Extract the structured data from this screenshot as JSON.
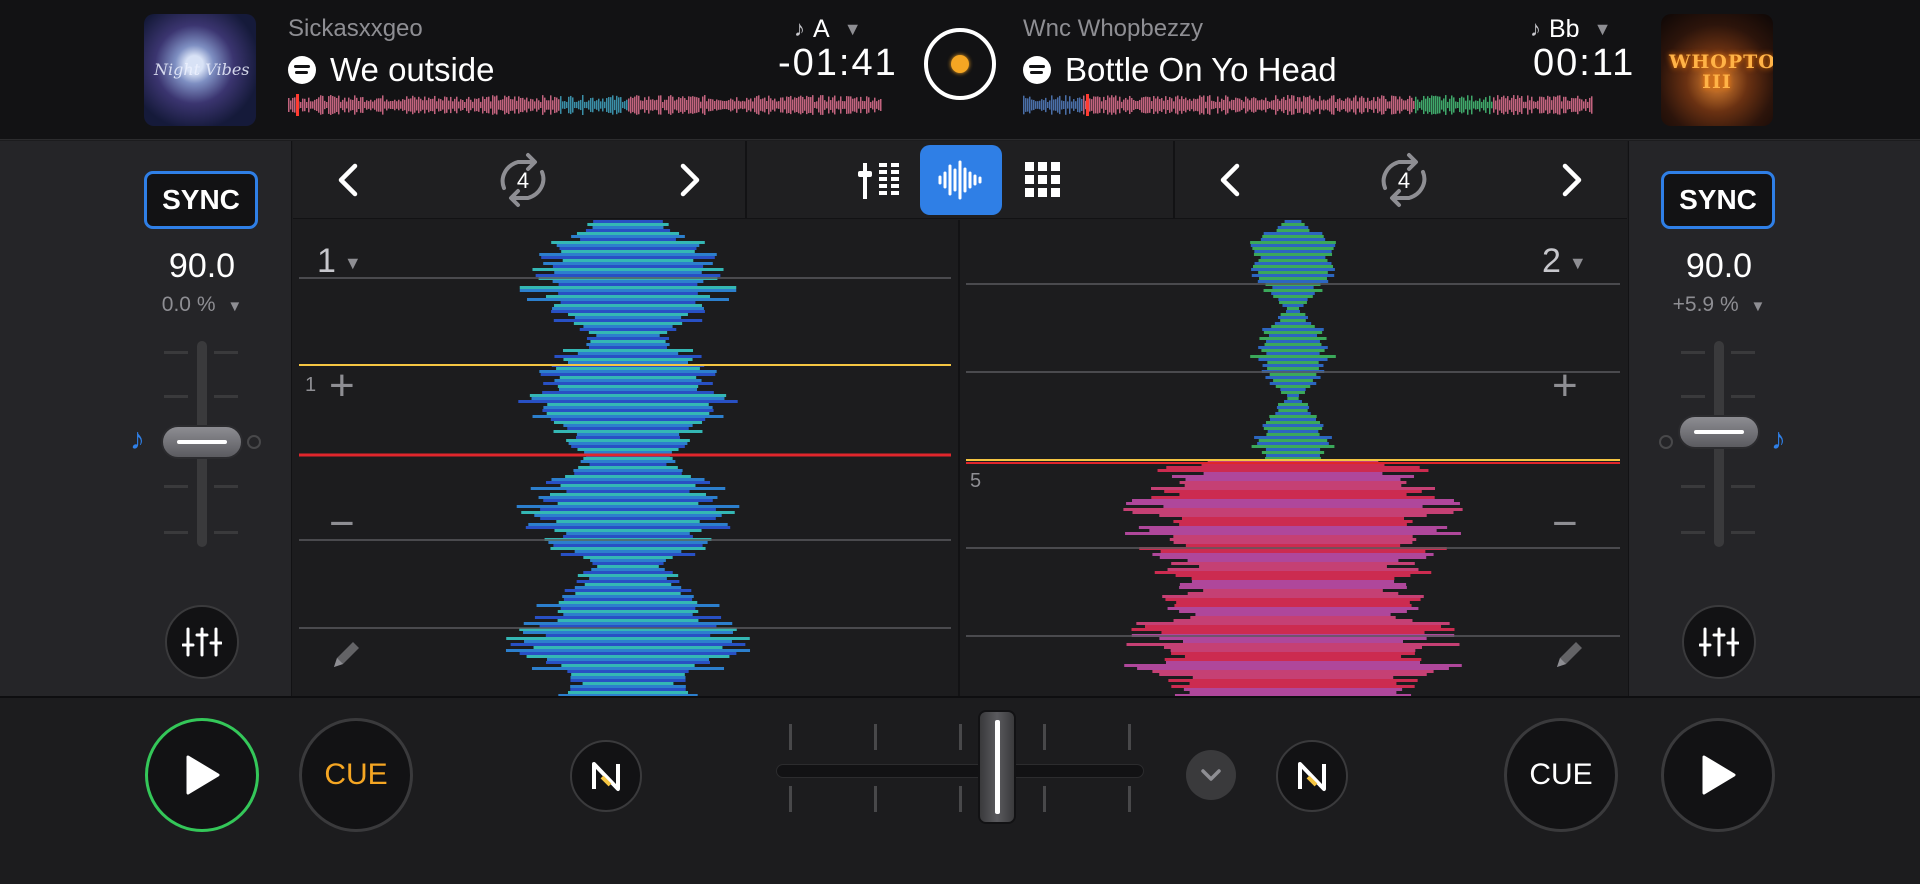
{
  "deck_a": {
    "artist": "Sickasxxgeo",
    "title": "We outside",
    "key": "A",
    "time": "-01:41",
    "artwork_text": "Night Vibes",
    "sync_label": "SYNC",
    "bpm": "90.0",
    "pitch": "0.0 %",
    "deck_number": "1",
    "loop_marker": "1",
    "cue_label": "CUE",
    "loop_length": "4"
  },
  "deck_b": {
    "artist": "Wnc Whopbezzy",
    "title": "Bottle On Yo Head",
    "key": "Bb",
    "time": "00:11",
    "artwork_text": "WHOPTOBER III",
    "sync_label": "SYNC",
    "bpm": "90.0",
    "pitch": "+5.9 %",
    "deck_number": "2",
    "loop_marker": "5",
    "cue_label": "CUE",
    "loop_length": "4"
  },
  "icons": {
    "streaming": "spotify-icon",
    "key_note": "music-note-icon",
    "view_modes": [
      "mixer-view-icon",
      "waveform-view-icon",
      "pads-view-icon"
    ],
    "loop": "loop-icon",
    "eq": "eq-sliders-icon",
    "neural_mix": "neural-mix-icon"
  },
  "colors": {
    "accent": "#2f7fe6",
    "play_active": "#34c759",
    "cue_active": "#f5a623",
    "center_indicator": "#f5a623"
  }
}
